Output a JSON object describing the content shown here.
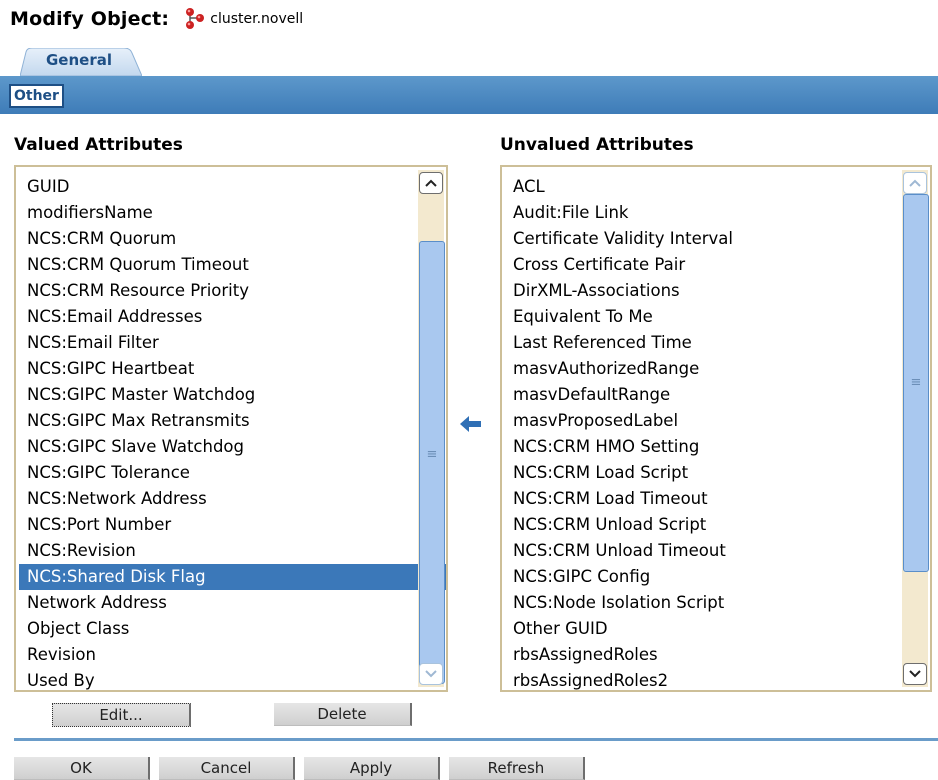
{
  "header": {
    "title": "Modify Object:",
    "object_name": "cluster.novell",
    "object_icon": "cluster-object-icon"
  },
  "tabs": {
    "main": "General",
    "sub": "Other"
  },
  "valued": {
    "heading": "Valued Attributes",
    "items": [
      "GUID",
      "modifiersName",
      "NCS:CRM Quorum",
      "NCS:CRM Quorum Timeout",
      "NCS:CRM Resource Priority",
      "NCS:Email Addresses",
      "NCS:Email Filter",
      "NCS:GIPC Heartbeat",
      "NCS:GIPC Master Watchdog",
      "NCS:GIPC Max Retransmits",
      "NCS:GIPC Slave Watchdog",
      "NCS:GIPC Tolerance",
      "NCS:Network Address",
      "NCS:Port Number",
      "NCS:Revision",
      "NCS:Shared Disk Flag",
      "Network Address",
      "Object Class",
      "Revision",
      "Used By"
    ],
    "selected": "NCS:Shared Disk Flag"
  },
  "unvalued": {
    "heading": "Unvalued Attributes",
    "items": [
      "ACL",
      "Audit:File Link",
      "Certificate Validity Interval",
      "Cross Certificate Pair",
      "DirXML-Associations",
      "Equivalent To Me",
      "Last Referenced Time",
      "masvAuthorizedRange",
      "masvDefaultRange",
      "masvProposedLabel",
      "NCS:CRM HMO Setting",
      "NCS:CRM Load Script",
      "NCS:CRM Load Timeout",
      "NCS:CRM Unload Script",
      "NCS:CRM Unload Timeout",
      "NCS:GIPC Config",
      "NCS:Node Isolation Script",
      "Other GUID",
      "rbsAssignedRoles",
      "rbsAssignedRoles2"
    ]
  },
  "move_icon": "arrow-left-icon",
  "buttons": {
    "edit": "Edit...",
    "delete": "Delete",
    "ok": "OK",
    "cancel": "Cancel",
    "apply": "Apply",
    "refresh": "Refresh"
  },
  "colors": {
    "accent": "#3e7cb8",
    "selection": "#3b78b9",
    "tab_text": "#1e4f85",
    "list_border": "#cdbf98"
  }
}
